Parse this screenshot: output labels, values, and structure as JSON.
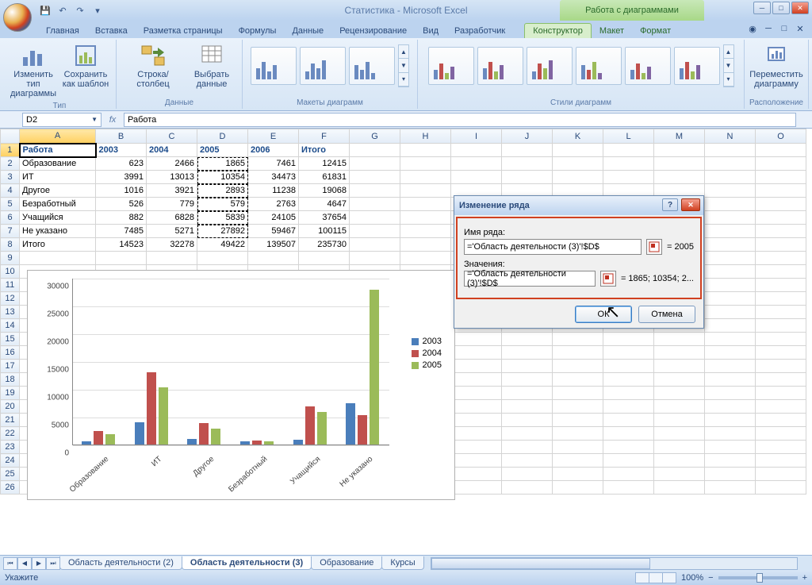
{
  "app": {
    "title": "Статистика - Microsoft Excel",
    "context_title": "Работа с диаграммами"
  },
  "qat": [
    "save",
    "undo",
    "redo"
  ],
  "tabs": {
    "items": [
      "Главная",
      "Вставка",
      "Разметка страницы",
      "Формулы",
      "Данные",
      "Рецензирование",
      "Вид",
      "Разработчик"
    ],
    "context": [
      "Конструктор",
      "Макет",
      "Формат"
    ],
    "active": "Конструктор"
  },
  "ribbon": {
    "groups": {
      "type": {
        "label": "Тип",
        "btn1": "Изменить тип диаграммы",
        "btn2": "Сохранить как шаблон"
      },
      "data": {
        "label": "Данные",
        "btn1": "Строка/столбец",
        "btn2": "Выбрать данные"
      },
      "layouts": {
        "label": "Макеты диаграмм"
      },
      "styles": {
        "label": "Стили диаграмм"
      },
      "location": {
        "label": "Расположение",
        "btn": "Переместить диаграмму"
      }
    }
  },
  "namebox": "D2",
  "formula": "Работа",
  "columns": [
    "A",
    "B",
    "C",
    "D",
    "E",
    "F",
    "G",
    "H",
    "I",
    "J",
    "K",
    "L",
    "M",
    "N",
    "O"
  ],
  "header_row": [
    "Работа",
    "2003",
    "2004",
    "2005",
    "2006",
    "Итого"
  ],
  "rows": [
    {
      "label": "Образование",
      "v": [
        623,
        2466,
        1865,
        7461,
        12415
      ]
    },
    {
      "label": "ИТ",
      "v": [
        3991,
        13013,
        10354,
        34473,
        61831
      ]
    },
    {
      "label": "Другое",
      "v": [
        1016,
        3921,
        2893,
        11238,
        19068
      ]
    },
    {
      "label": "Безработный",
      "v": [
        526,
        779,
        579,
        2763,
        4647
      ]
    },
    {
      "label": "Учащийся",
      "v": [
        882,
        6828,
        5839,
        24105,
        37654
      ]
    },
    {
      "label": "Не указано",
      "v": [
        7485,
        5271,
        27892,
        59467,
        100115
      ]
    },
    {
      "label": "Итого",
      "v": [
        14523,
        32278,
        49422,
        139507,
        235730
      ]
    }
  ],
  "chart_data": {
    "type": "bar",
    "categories": [
      "Образование",
      "ИТ",
      "Другое",
      "Безработный",
      "Учащийся",
      "Не указано"
    ],
    "series": [
      {
        "name": "2003",
        "values": [
          623,
          3991,
          1016,
          526,
          882,
          7485
        ],
        "color": "#4a7ebb"
      },
      {
        "name": "2004",
        "values": [
          2466,
          13013,
          3921,
          779,
          6828,
          5271
        ],
        "color": "#c0504d"
      },
      {
        "name": "2005",
        "values": [
          1865,
          10354,
          2893,
          579,
          5839,
          27892
        ],
        "color": "#9bbb59"
      }
    ],
    "ylim": [
      0,
      30000
    ],
    "ystep": 5000,
    "title": "",
    "xlabel": "",
    "ylabel": ""
  },
  "dialog": {
    "title": "Изменение ряда",
    "name_label": "Имя ряда:",
    "name_value": "='Область деятельности (3)'!$D$",
    "name_result": "=  2005",
    "values_label": "Значения:",
    "values_value": "='Область деятельности (3)'!$D$",
    "values_result": "=  1865; 10354; 2...",
    "ok": "ОК",
    "cancel": "Отмена"
  },
  "sheet_tabs": [
    "Область деятельности (2)",
    "Область деятельности (3)",
    "Образование",
    "Курсы"
  ],
  "active_sheet": "Область деятельности (3)",
  "status": {
    "mode": "Укажите",
    "zoom": "100%"
  }
}
